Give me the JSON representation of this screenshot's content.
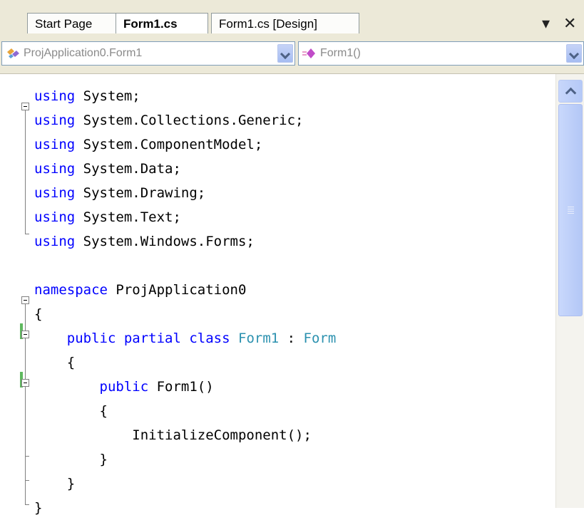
{
  "tabs": [
    {
      "label": "Start Page",
      "active": false
    },
    {
      "label": "Form1.cs",
      "active": true
    },
    {
      "label": "Form1.cs [Design]",
      "active": false
    }
  ],
  "tab_controls": {
    "dropdown_glyph": "▾",
    "close_glyph": "✕"
  },
  "nav": {
    "type_combo": {
      "value": "ProjApplication0.Form1",
      "icon": "class-icon"
    },
    "member_combo": {
      "value": "Form1()",
      "icon": "method-icon"
    }
  },
  "code_lines": [
    {
      "parts": [
        {
          "t": "using",
          "c": "kw"
        },
        {
          "t": " System;",
          "c": ""
        }
      ]
    },
    {
      "parts": [
        {
          "t": "using",
          "c": "kw"
        },
        {
          "t": " System.Collections.Generic;",
          "c": ""
        }
      ]
    },
    {
      "parts": [
        {
          "t": "using",
          "c": "kw"
        },
        {
          "t": " System.ComponentModel;",
          "c": ""
        }
      ]
    },
    {
      "parts": [
        {
          "t": "using",
          "c": "kw"
        },
        {
          "t": " System.Data;",
          "c": ""
        }
      ]
    },
    {
      "parts": [
        {
          "t": "using",
          "c": "kw"
        },
        {
          "t": " System.Drawing;",
          "c": ""
        }
      ]
    },
    {
      "parts": [
        {
          "t": "using",
          "c": "kw"
        },
        {
          "t": " System.Text;",
          "c": ""
        }
      ]
    },
    {
      "parts": [
        {
          "t": "using",
          "c": "kw"
        },
        {
          "t": " System.Windows.Forms;",
          "c": ""
        }
      ]
    },
    {
      "parts": []
    },
    {
      "parts": [
        {
          "t": "namespace",
          "c": "kw"
        },
        {
          "t": " ProjApplication0",
          "c": ""
        }
      ]
    },
    {
      "parts": [
        {
          "t": "{",
          "c": ""
        }
      ]
    },
    {
      "parts": [
        {
          "t": "    ",
          "c": ""
        },
        {
          "t": "public partial class",
          "c": "kw"
        },
        {
          "t": " ",
          "c": ""
        },
        {
          "t": "Form1",
          "c": "ty"
        },
        {
          "t": " : ",
          "c": ""
        },
        {
          "t": "Form",
          "c": "ty"
        }
      ]
    },
    {
      "parts": [
        {
          "t": "    {",
          "c": ""
        }
      ]
    },
    {
      "parts": [
        {
          "t": "        ",
          "c": ""
        },
        {
          "t": "public",
          "c": "kw"
        },
        {
          "t": " Form1()",
          "c": ""
        }
      ]
    },
    {
      "parts": [
        {
          "t": "        {",
          "c": ""
        }
      ]
    },
    {
      "parts": [
        {
          "t": "            InitializeComponent();",
          "c": ""
        }
      ]
    },
    {
      "parts": [
        {
          "t": "        }",
          "c": ""
        }
      ]
    },
    {
      "parts": [
        {
          "t": "    }",
          "c": ""
        }
      ]
    },
    {
      "parts": [
        {
          "t": "}",
          "c": ""
        }
      ]
    }
  ],
  "colors": {
    "keyword": "#0000ff",
    "type": "#2b91af",
    "text": "#000000",
    "changed_marker": "#5fb85f"
  }
}
